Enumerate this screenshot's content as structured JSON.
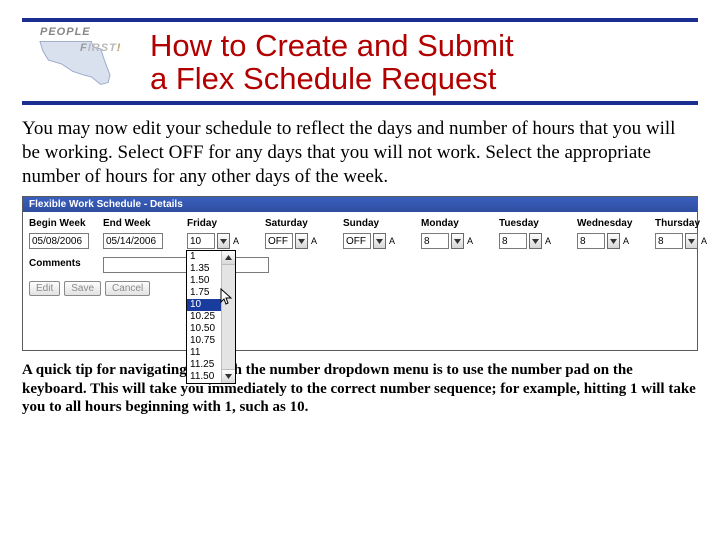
{
  "logo": {
    "people": "PEOPLE",
    "first_f": "F",
    "first_rest": "IRST",
    "bang": "!"
  },
  "title_line1": "How to Create and Submit",
  "title_line2": "a Flex Schedule Request",
  "instructions": "You may now edit your schedule to reflect the days and number of hours that you will be working.  Select OFF for any days that you will not work.  Select the appropriate number of hours for any other days of the week.",
  "panel": {
    "title": "Flexible Work Schedule - Details",
    "labels": {
      "begin": "Begin Week",
      "end": "End Week",
      "comments": "Comments",
      "days": [
        "Friday",
        "Saturday",
        "Sunday",
        "Monday",
        "Tuesday",
        "Wednesday",
        "Thursday"
      ]
    },
    "values": {
      "begin": "05/08/2006",
      "end": "05/14/2006",
      "days": [
        "10",
        "OFF",
        "OFF",
        "8",
        "8",
        "8",
        "8"
      ],
      "comments": ""
    },
    "suffix": "A",
    "dropdown_options": [
      "1",
      "1.35",
      "1.50",
      "1.75",
      "10",
      "10.25",
      "10.50",
      "10.75",
      "11",
      "11.25",
      "11.50"
    ],
    "dropdown_selected_index": 4,
    "buttons": {
      "edit": "Edit",
      "save": "Save",
      "cancel": "Cancel"
    }
  },
  "tip": "A quick tip for navigating through the number dropdown menu is to use the number pad on the keyboard.  This will take you immediately to the correct number sequence; for example, hitting 1 will take you to all hours beginning with 1, such as 10."
}
